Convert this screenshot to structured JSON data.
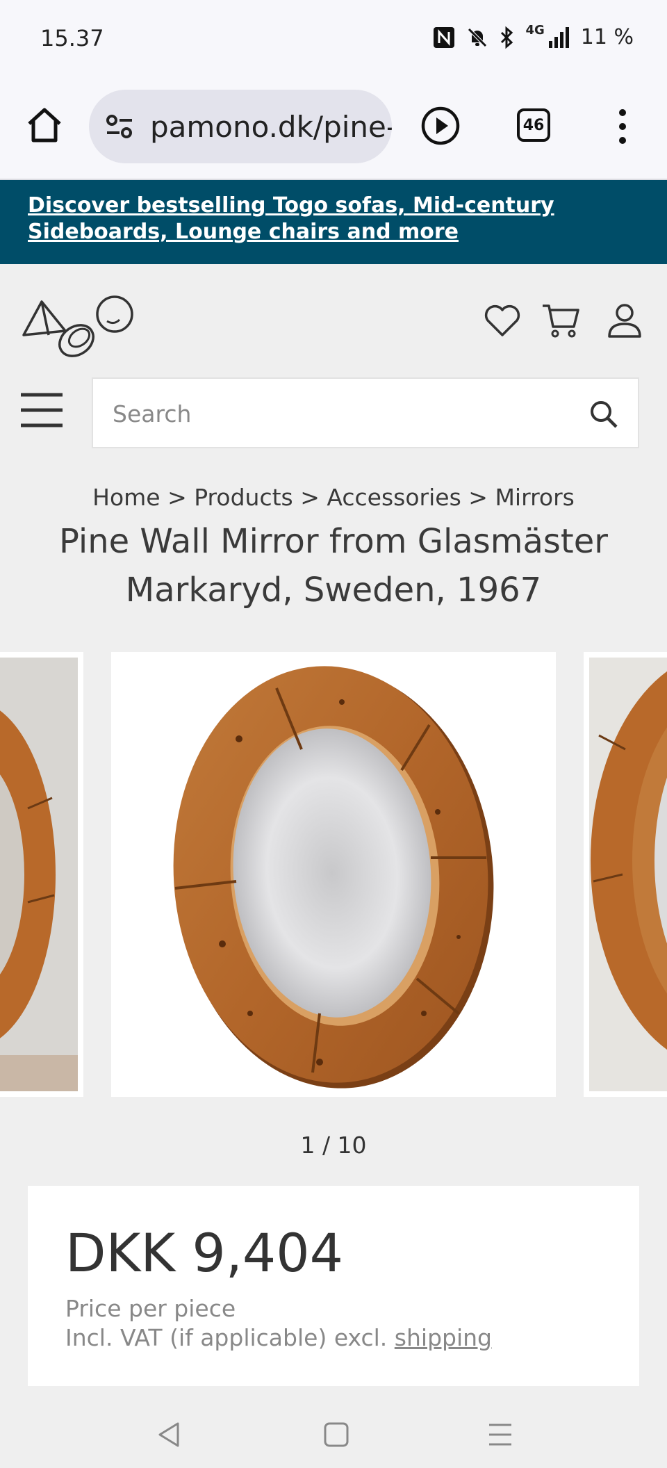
{
  "status_bar": {
    "time": "15.37",
    "network": "4G",
    "battery": "11 %"
  },
  "browser": {
    "url": "pamono.dk/pine-",
    "tab_count": "46"
  },
  "promo": {
    "text": "Discover bestselling Togo sofas, Mid-century Sideboards, Lounge chairs and more"
  },
  "search": {
    "placeholder": "Search"
  },
  "breadcrumb": {
    "items": [
      "Home",
      "Products",
      "Accessories",
      "Mirrors"
    ],
    "separator": ">"
  },
  "product": {
    "title": "Pine Wall Mirror from Glasmäster Markaryd, Sweden, 1967",
    "gallery_counter": "1 / 10",
    "price": "DKK 9,404",
    "price_per": "Price per piece",
    "vat_note": "Incl. VAT (if applicable) excl.",
    "shipping_link": "shipping"
  },
  "colors": {
    "promo_bg": "#004d68",
    "page_bg": "#efefef",
    "pine": "#b8692a"
  },
  "icons": [
    "home-icon",
    "site-settings-icon",
    "play-icon",
    "tab-switcher-icon",
    "more-icon",
    "wishlist-icon",
    "cart-icon",
    "account-icon",
    "menu-icon",
    "search-icon",
    "back-icon",
    "home-nav-icon",
    "recents-icon"
  ]
}
